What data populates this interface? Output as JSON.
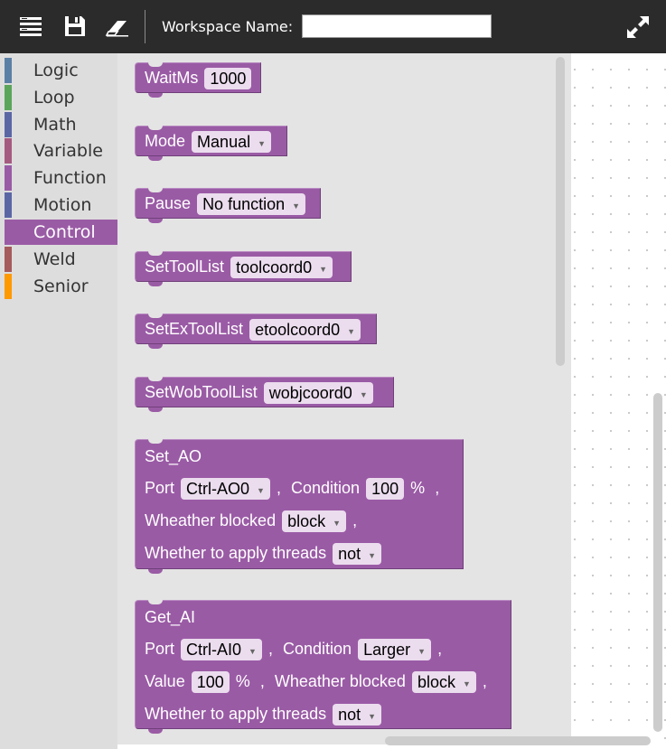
{
  "toolbar": {
    "workspace_label": "Workspace Name:",
    "workspace_value": "",
    "icons": [
      "menu-list-icon",
      "save-icon",
      "eraser-icon",
      "fullscreen-icon"
    ]
  },
  "categories": [
    {
      "label": "Logic",
      "color": "#5b80a5"
    },
    {
      "label": "Loop",
      "color": "#5ba55b"
    },
    {
      "label": "Math",
      "color": "#5b67a5"
    },
    {
      "label": "Variable",
      "color": "#a55b80"
    },
    {
      "label": "Function",
      "color": "#995ba5"
    },
    {
      "label": "Motion",
      "color": "#5b67a5"
    },
    {
      "label": "Control",
      "color": "#9a5ba5"
    },
    {
      "label": "Weld",
      "color": "#a55b5b"
    },
    {
      "label": "Senior",
      "color": "#ff9900"
    }
  ],
  "selected_category": "Control",
  "blocks": {
    "waitms": {
      "label": "WaitMs",
      "value": "1000"
    },
    "mode": {
      "label": "Mode",
      "value": "Manual"
    },
    "pause": {
      "label": "Pause",
      "value": "No function"
    },
    "settoollist": {
      "label": "SetToolList",
      "value": "toolcoord0"
    },
    "setextoollist": {
      "label": "SetExToolList",
      "value": "etoolcoord0"
    },
    "setwobtoollist": {
      "label": "SetWobToolList",
      "value": "wobjcoord0"
    },
    "set_ao": {
      "title": "Set_AO",
      "port_label": "Port",
      "port_value": "Ctrl-AO0",
      "sep1": ",",
      "condition_label": "Condition",
      "condition_value": "100",
      "percent": "%",
      "sep2": ",",
      "blocked_label": "Wheather blocked",
      "blocked_value": "block",
      "sep3": ",",
      "threads_label": "Whether to apply threads",
      "threads_value": "not"
    },
    "get_ai": {
      "title": "Get_AI",
      "port_label": "Port",
      "port_value": "Ctrl-AI0",
      "sep1": ",",
      "condition_label": "Condition",
      "condition_value": "Larger",
      "sep2": ",",
      "value_label": "Value",
      "value_value": "100",
      "percent": "%",
      "sep3": ",",
      "blocked_label": "Wheather blocked",
      "blocked_value": "block",
      "sep4": ",",
      "threads_label": "Whether to apply threads",
      "threads_value": "not"
    }
  },
  "dropdown_arrow": "▼"
}
